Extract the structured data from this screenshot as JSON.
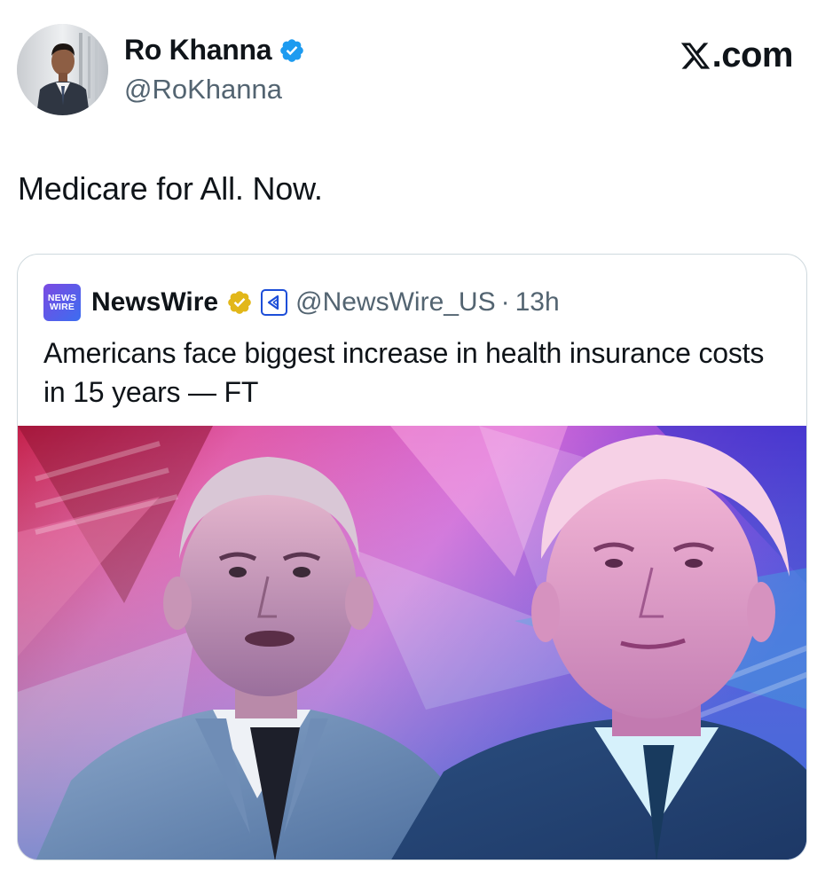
{
  "author": {
    "name": "Ro Khanna",
    "handle": "@RoKhanna",
    "verified_badge_color": "#1d9bf0",
    "avatar_icon": "profile-photo"
  },
  "brand": {
    "label": ".com",
    "logo_icon": "x-logo-icon"
  },
  "tweet": {
    "text": "Medicare for All. Now."
  },
  "quote": {
    "logo_line1": "NEWS",
    "logo_line2": "WIRE",
    "name": "NewsWire",
    "handle": "@NewsWire_US",
    "separator": "·",
    "time": "13h",
    "badge_color": "#e2b719",
    "text": "Americans face biggest increase in health insurance costs in 15 years — FT",
    "image_icon": "news-photo-two-men"
  },
  "colors": {
    "text": "#0f1419",
    "secondary": "#536471",
    "border": "#cfd9de"
  }
}
